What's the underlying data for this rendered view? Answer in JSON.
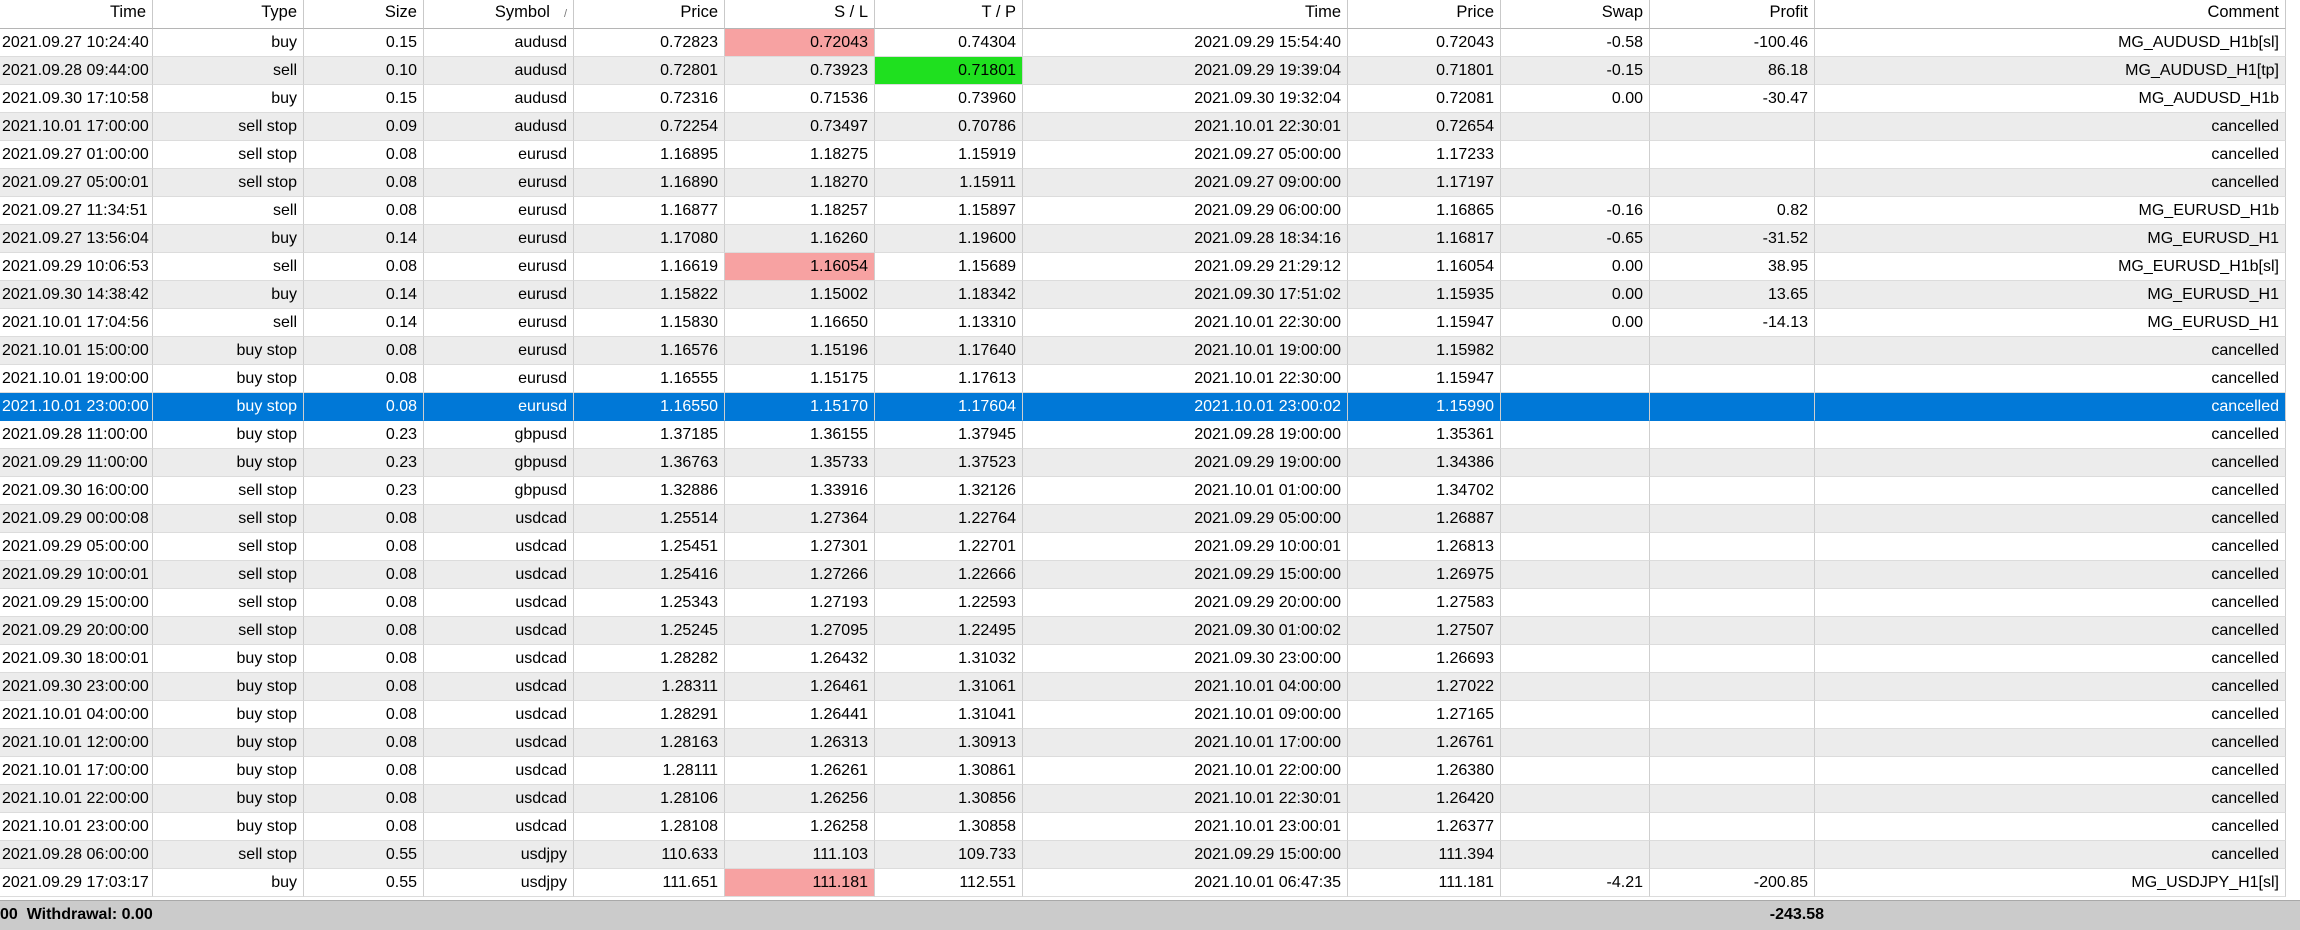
{
  "columns": [
    "Time",
    "Type",
    "Size",
    "Symbol",
    "Price",
    "S / L",
    "T / P",
    "Time",
    "Price",
    "Swap",
    "Profit",
    "Comment"
  ],
  "sort_indicator": "/",
  "rows": [
    [
      "2021.09.27 10:24:40",
      "buy",
      "0.15",
      "audusd",
      "0.72823",
      "0.72043",
      "0.74304",
      "2021.09.29 15:54:40",
      "0.72043",
      "-0.58",
      "-100.46",
      "MG_AUDUSD_H1b[sl]"
    ],
    [
      "2021.09.28 09:44:00",
      "sell",
      "0.10",
      "audusd",
      "0.72801",
      "0.73923",
      "0.71801",
      "2021.09.29 19:39:04",
      "0.71801",
      "-0.15",
      "86.18",
      "MG_AUDUSD_H1[tp]"
    ],
    [
      "2021.09.30 17:10:58",
      "buy",
      "0.15",
      "audusd",
      "0.72316",
      "0.71536",
      "0.73960",
      "2021.09.30 19:32:04",
      "0.72081",
      "0.00",
      "-30.47",
      "MG_AUDUSD_H1b"
    ],
    [
      "2021.10.01 17:00:00",
      "sell stop",
      "0.09",
      "audusd",
      "0.72254",
      "0.73497",
      "0.70786",
      "2021.10.01 22:30:01",
      "0.72654",
      "",
      "",
      "cancelled"
    ],
    [
      "2021.09.27 01:00:00",
      "sell stop",
      "0.08",
      "eurusd",
      "1.16895",
      "1.18275",
      "1.15919",
      "2021.09.27 05:00:00",
      "1.17233",
      "",
      "",
      "cancelled"
    ],
    [
      "2021.09.27 05:00:01",
      "sell stop",
      "0.08",
      "eurusd",
      "1.16890",
      "1.18270",
      "1.15911",
      "2021.09.27 09:00:00",
      "1.17197",
      "",
      "",
      "cancelled"
    ],
    [
      "2021.09.27 11:34:51",
      "sell",
      "0.08",
      "eurusd",
      "1.16877",
      "1.18257",
      "1.15897",
      "2021.09.29 06:00:00",
      "1.16865",
      "-0.16",
      "0.82",
      "MG_EURUSD_H1b"
    ],
    [
      "2021.09.27 13:56:04",
      "buy",
      "0.14",
      "eurusd",
      "1.17080",
      "1.16260",
      "1.19600",
      "2021.09.28 18:34:16",
      "1.16817",
      "-0.65",
      "-31.52",
      "MG_EURUSD_H1"
    ],
    [
      "2021.09.29 10:06:53",
      "sell",
      "0.08",
      "eurusd",
      "1.16619",
      "1.16054",
      "1.15689",
      "2021.09.29 21:29:12",
      "1.16054",
      "0.00",
      "38.95",
      "MG_EURUSD_H1b[sl]"
    ],
    [
      "2021.09.30 14:38:42",
      "buy",
      "0.14",
      "eurusd",
      "1.15822",
      "1.15002",
      "1.18342",
      "2021.09.30 17:51:02",
      "1.15935",
      "0.00",
      "13.65",
      "MG_EURUSD_H1"
    ],
    [
      "2021.10.01 17:04:56",
      "sell",
      "0.14",
      "eurusd",
      "1.15830",
      "1.16650",
      "1.13310",
      "2021.10.01 22:30:00",
      "1.15947",
      "0.00",
      "-14.13",
      "MG_EURUSD_H1"
    ],
    [
      "2021.10.01 15:00:00",
      "buy stop",
      "0.08",
      "eurusd",
      "1.16576",
      "1.15196",
      "1.17640",
      "2021.10.01 19:00:00",
      "1.15982",
      "",
      "",
      "cancelled"
    ],
    [
      "2021.10.01 19:00:00",
      "buy stop",
      "0.08",
      "eurusd",
      "1.16555",
      "1.15175",
      "1.17613",
      "2021.10.01 22:30:00",
      "1.15947",
      "",
      "",
      "cancelled"
    ],
    [
      "2021.10.01 23:00:00",
      "buy stop",
      "0.08",
      "eurusd",
      "1.16550",
      "1.15170",
      "1.17604",
      "2021.10.01 23:00:02",
      "1.15990",
      "",
      "",
      "cancelled"
    ],
    [
      "2021.09.28 11:00:00",
      "buy stop",
      "0.23",
      "gbpusd",
      "1.37185",
      "1.36155",
      "1.37945",
      "2021.09.28 19:00:00",
      "1.35361",
      "",
      "",
      "cancelled"
    ],
    [
      "2021.09.29 11:00:00",
      "buy stop",
      "0.23",
      "gbpusd",
      "1.36763",
      "1.35733",
      "1.37523",
      "2021.09.29 19:00:00",
      "1.34386",
      "",
      "",
      "cancelled"
    ],
    [
      "2021.09.30 16:00:00",
      "sell stop",
      "0.23",
      "gbpusd",
      "1.32886",
      "1.33916",
      "1.32126",
      "2021.10.01 01:00:00",
      "1.34702",
      "",
      "",
      "cancelled"
    ],
    [
      "2021.09.29 00:00:08",
      "sell stop",
      "0.08",
      "usdcad",
      "1.25514",
      "1.27364",
      "1.22764",
      "2021.09.29 05:00:00",
      "1.26887",
      "",
      "",
      "cancelled"
    ],
    [
      "2021.09.29 05:00:00",
      "sell stop",
      "0.08",
      "usdcad",
      "1.25451",
      "1.27301",
      "1.22701",
      "2021.09.29 10:00:01",
      "1.26813",
      "",
      "",
      "cancelled"
    ],
    [
      "2021.09.29 10:00:01",
      "sell stop",
      "0.08",
      "usdcad",
      "1.25416",
      "1.27266",
      "1.22666",
      "2021.09.29 15:00:00",
      "1.26975",
      "",
      "",
      "cancelled"
    ],
    [
      "2021.09.29 15:00:00",
      "sell stop",
      "0.08",
      "usdcad",
      "1.25343",
      "1.27193",
      "1.22593",
      "2021.09.29 20:00:00",
      "1.27583",
      "",
      "",
      "cancelled"
    ],
    [
      "2021.09.29 20:00:00",
      "sell stop",
      "0.08",
      "usdcad",
      "1.25245",
      "1.27095",
      "1.22495",
      "2021.09.30 01:00:02",
      "1.27507",
      "",
      "",
      "cancelled"
    ],
    [
      "2021.09.30 18:00:01",
      "buy stop",
      "0.08",
      "usdcad",
      "1.28282",
      "1.26432",
      "1.31032",
      "2021.09.30 23:00:00",
      "1.26693",
      "",
      "",
      "cancelled"
    ],
    [
      "2021.09.30 23:00:00",
      "buy stop",
      "0.08",
      "usdcad",
      "1.28311",
      "1.26461",
      "1.31061",
      "2021.10.01 04:00:00",
      "1.27022",
      "",
      "",
      "cancelled"
    ],
    [
      "2021.10.01 04:00:00",
      "buy stop",
      "0.08",
      "usdcad",
      "1.28291",
      "1.26441",
      "1.31041",
      "2021.10.01 09:00:00",
      "1.27165",
      "",
      "",
      "cancelled"
    ],
    [
      "2021.10.01 12:00:00",
      "buy stop",
      "0.08",
      "usdcad",
      "1.28163",
      "1.26313",
      "1.30913",
      "2021.10.01 17:00:00",
      "1.26761",
      "",
      "",
      "cancelled"
    ],
    [
      "2021.10.01 17:00:00",
      "buy stop",
      "0.08",
      "usdcad",
      "1.28111",
      "1.26261",
      "1.30861",
      "2021.10.01 22:00:00",
      "1.26380",
      "",
      "",
      "cancelled"
    ],
    [
      "2021.10.01 22:00:00",
      "buy stop",
      "0.08",
      "usdcad",
      "1.28106",
      "1.26256",
      "1.30856",
      "2021.10.01 22:30:01",
      "1.26420",
      "",
      "",
      "cancelled"
    ],
    [
      "2021.10.01 23:00:00",
      "buy stop",
      "0.08",
      "usdcad",
      "1.28108",
      "1.26258",
      "1.30858",
      "2021.10.01 23:00:01",
      "1.26377",
      "",
      "",
      "cancelled"
    ],
    [
      "2021.09.28 06:00:00",
      "sell stop",
      "0.55",
      "usdjpy",
      "110.633",
      "111.103",
      "109.733",
      "2021.09.29 15:00:00",
      "111.394",
      "",
      "",
      "cancelled"
    ],
    [
      "2021.09.29 17:03:17",
      "buy",
      "0.55",
      "usdjpy",
      "111.651",
      "111.181",
      "112.551",
      "2021.10.01 06:47:35",
      "111.181",
      "-4.21",
      "-200.85",
      "MG_USDJPY_H1[sl]"
    ]
  ],
  "selected_row": 13,
  "highlights": {
    "sl_hit_rows": [
      0,
      8,
      30
    ],
    "tp_hit_rows": [
      1
    ],
    "sl_hit_color": "#f7a2a2",
    "tp_hit_color": "#1fe01f",
    "selection_color": "#0078d7"
  },
  "footer": {
    "summary": "00  Withdrawal: 0.00",
    "total_profit": "-243.58"
  }
}
